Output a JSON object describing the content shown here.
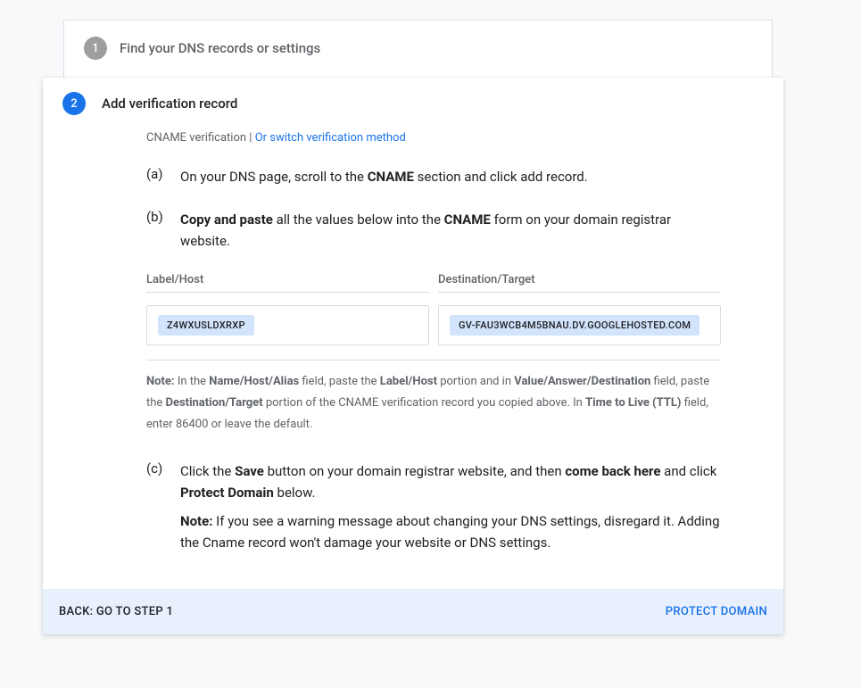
{
  "step1": {
    "number": "1",
    "title": "Find your DNS records or settings"
  },
  "step2": {
    "number": "2",
    "title": "Add verification record",
    "verification_label": "CNAME verification",
    "separator": " | ",
    "switch_link": "Or switch verification method",
    "a": {
      "letter": "(a)",
      "pre": "On your DNS page, scroll to the ",
      "bold": "CNAME",
      "post": " section and click add record."
    },
    "b": {
      "letter": "(b)",
      "bold1": "Copy and paste",
      "mid": " all the values below into the ",
      "bold2": "CNAME",
      "post": " form on your domain registrar website."
    },
    "fields": {
      "host_label": "Label/Host",
      "host_value": "Z4WXUSLDXRXP",
      "dest_label": "Destination/Target",
      "dest_value": "GV-FAU3WCB4M5BNAU.DV.GOOGLEHOSTED.COM"
    },
    "note": {
      "b1": "Note:",
      "t1": " In the ",
      "b2": "Name/Host/Alias",
      "t2": " field, paste the ",
      "b3": "Label/Host",
      "t3": " portion and in ",
      "b4": "Value/Answer/Destination",
      "t4": " field, paste the ",
      "b5": "Destination/Target",
      "t5": " portion of the CNAME verification record you copied above. In ",
      "b6": "Time to Live (TTL)",
      "t6": " field, enter 86400 or leave the default."
    },
    "c": {
      "letter": "(c)",
      "t1": "Click the ",
      "b1": "Save",
      "t2": " button on your domain registrar website, and then ",
      "b2": "come back here",
      "t3": " and click ",
      "b3": "Protect Domain",
      "t4": " below.",
      "note_b": "Note:",
      "note_t": " If you see a warning message about changing your DNS settings, disregard it. Adding the Cname record won't damage your website or DNS settings."
    }
  },
  "footer": {
    "back": "BACK: GO TO STEP 1",
    "protect": "PROTECT DOMAIN"
  }
}
